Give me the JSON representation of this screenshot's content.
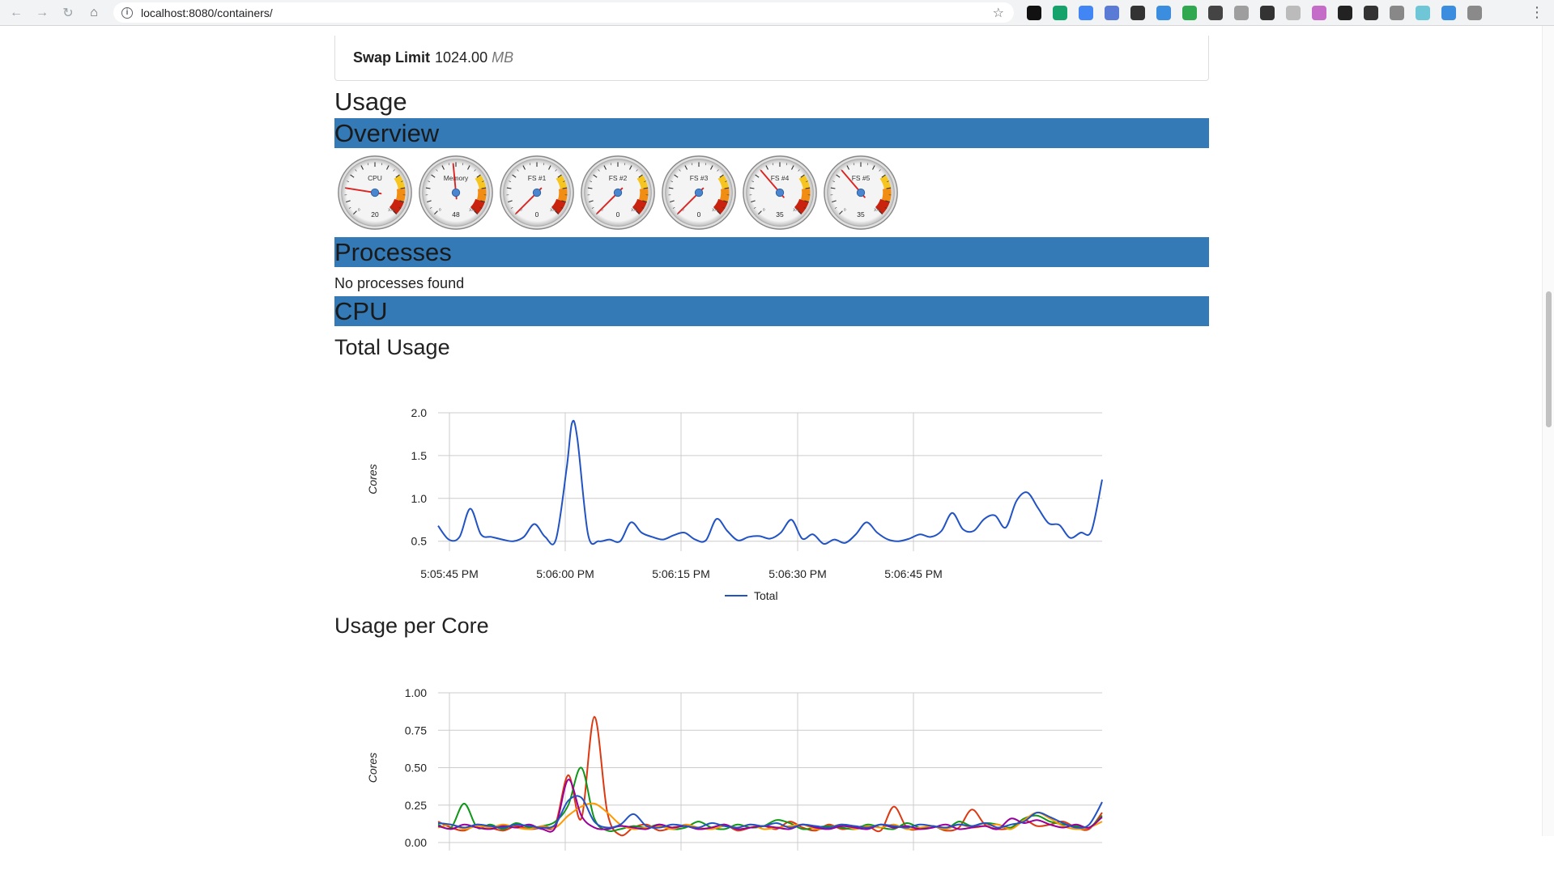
{
  "browser": {
    "url": "localhost:8080/containers/",
    "extensions": [
      "#111111",
      "#15a36b",
      "#4285f4",
      "#5a7bd5",
      "#333333",
      "#3b8de0",
      "#2fa84f",
      "#444444",
      "#9e9e9e",
      "#333333",
      "#bbbbbb",
      "#c56bc8",
      "#222222",
      "#333333",
      "#888888",
      "#6ec6d6",
      "#3b8de0",
      "#8a8a8a"
    ]
  },
  "machine": {
    "swap_label": "Swap Limit",
    "swap_value": "1024.00",
    "swap_unit": "MB"
  },
  "usage_title": "Usage",
  "sections": {
    "overview": "Overview",
    "processes": "Processes",
    "cpu": "CPU"
  },
  "no_processes": "No processes found",
  "gauges": [
    {
      "label": "CPU",
      "value": "20",
      "percent": 20
    },
    {
      "label": "Memory",
      "value": "48",
      "percent": 48
    },
    {
      "label": "FS #1",
      "value": "0",
      "percent": 0
    },
    {
      "label": "FS #2",
      "value": "0",
      "percent": 0
    },
    {
      "label": "FS #3",
      "value": "0",
      "percent": 0
    },
    {
      "label": "FS #4",
      "value": "35",
      "percent": 35
    },
    {
      "label": "FS #5",
      "value": "35",
      "percent": 35
    }
  ],
  "gauge_scale": {
    "min": "0",
    "max": "100"
  },
  "charts": {
    "total_title": "Total Usage",
    "per_core_title": "Usage per Core"
  },
  "chart_data": [
    {
      "type": "line",
      "ylabel": "Cores",
      "ylim": [
        0.45,
        2.0
      ],
      "yticks": [
        "2.0",
        "1.5",
        "1.0",
        "0.5"
      ],
      "ytick_values": [
        2.0,
        1.5,
        1.0,
        0.5
      ],
      "xlim": [
        0,
        60
      ],
      "xticks": [
        "5:05:45 PM",
        "5:06:00 PM",
        "5:06:15 PM",
        "5:06:30 PM",
        "5:06:45 PM"
      ],
      "xtick_values": [
        10,
        25,
        40,
        55,
        70
      ],
      "x_note_unused": null,
      "legend": "bottom",
      "series": [
        {
          "name": "Total",
          "color": "#2253c4",
          "points": [
            [
              0,
              0.68
            ],
            [
              1,
              0.52
            ],
            [
              2,
              0.55
            ],
            [
              3,
              0.88
            ],
            [
              4,
              0.58
            ],
            [
              5,
              0.55
            ],
            [
              6,
              0.52
            ],
            [
              7,
              0.5
            ],
            [
              8,
              0.55
            ],
            [
              9,
              0.7
            ],
            [
              10,
              0.55
            ],
            [
              11,
              0.52
            ],
            [
              12,
              1.35
            ],
            [
              12.5,
              1.88
            ],
            [
              13,
              1.7
            ],
            [
              14,
              0.58
            ],
            [
              15,
              0.5
            ],
            [
              16,
              0.52
            ],
            [
              17,
              0.5
            ],
            [
              18,
              0.72
            ],
            [
              19,
              0.6
            ],
            [
              20,
              0.55
            ],
            [
              21,
              0.52
            ],
            [
              22,
              0.57
            ],
            [
              23,
              0.6
            ],
            [
              24,
              0.52
            ],
            [
              25,
              0.51
            ],
            [
              26,
              0.76
            ],
            [
              27,
              0.62
            ],
            [
              28,
              0.51
            ],
            [
              29,
              0.55
            ],
            [
              30,
              0.56
            ],
            [
              31,
              0.53
            ],
            [
              32,
              0.6
            ],
            [
              33,
              0.75
            ],
            [
              34,
              0.53
            ],
            [
              35,
              0.58
            ],
            [
              36,
              0.47
            ],
            [
              37,
              0.52
            ],
            [
              38,
              0.48
            ],
            [
              39,
              0.58
            ],
            [
              40,
              0.72
            ],
            [
              41,
              0.6
            ],
            [
              42,
              0.52
            ],
            [
              43,
              0.5
            ],
            [
              44,
              0.53
            ],
            [
              45,
              0.58
            ],
            [
              46,
              0.55
            ],
            [
              47,
              0.62
            ],
            [
              48,
              0.83
            ],
            [
              49,
              0.64
            ],
            [
              50,
              0.62
            ],
            [
              51,
              0.76
            ],
            [
              52,
              0.8
            ],
            [
              53,
              0.66
            ],
            [
              54,
              0.97
            ],
            [
              55,
              1.07
            ],
            [
              56,
              0.89
            ],
            [
              57,
              0.71
            ],
            [
              58,
              0.69
            ],
            [
              59,
              0.54
            ],
            [
              60,
              0.6
            ],
            [
              61,
              0.62
            ],
            [
              62,
              1.22
            ]
          ]
        }
      ]
    },
    {
      "type": "line",
      "ylabel": "Cores",
      "ylim": [
        0,
        1.0
      ],
      "yticks": [
        "1.00",
        "0.75",
        "0.50",
        "0.25",
        "0.00"
      ],
      "ytick_values": [
        1.0,
        0.75,
        0.5,
        0.25,
        0.0
      ],
      "xticks": [],
      "series": [
        {
          "color": "#dc3912",
          "values": [
            0.14,
            0.1,
            0.08,
            0.12,
            0.1,
            0.08,
            0.11,
            0.09,
            0.1,
            0.12,
            0.45,
            0.16,
            0.84,
            0.2,
            0.05,
            0.1,
            0.12,
            0.08,
            0.1,
            0.11,
            0.09,
            0.1,
            0.12,
            0.08,
            0.1,
            0.11,
            0.09,
            0.14,
            0.1,
            0.08,
            0.12,
            0.09,
            0.1,
            0.11,
            0.08,
            0.24,
            0.1,
            0.09,
            0.11,
            0.08,
            0.1,
            0.22,
            0.12,
            0.09,
            0.1,
            0.15,
            0.11,
            0.12,
            0.14,
            0.1,
            0.09,
            0.2
          ]
        },
        {
          "color": "#109618",
          "values": [
            0.12,
            0.1,
            0.26,
            0.1,
            0.12,
            0.09,
            0.13,
            0.1,
            0.11,
            0.14,
            0.25,
            0.5,
            0.16,
            0.08,
            0.09,
            0.11,
            0.1,
            0.12,
            0.09,
            0.1,
            0.14,
            0.1,
            0.09,
            0.12,
            0.1,
            0.11,
            0.15,
            0.13,
            0.09,
            0.1,
            0.11,
            0.1,
            0.09,
            0.12,
            0.1,
            0.09,
            0.13,
            0.1,
            0.11,
            0.09,
            0.14,
            0.11,
            0.13,
            0.12,
            0.1,
            0.16,
            0.18,
            0.14,
            0.12,
            0.11,
            0.1,
            0.18
          ]
        },
        {
          "color": "#ff9900",
          "values": [
            0.1,
            0.12,
            0.09,
            0.11,
            0.1,
            0.12,
            0.1,
            0.09,
            0.11,
            0.1,
            0.18,
            0.24,
            0.26,
            0.2,
            0.12,
            0.09,
            0.1,
            0.11,
            0.09,
            0.12,
            0.1,
            0.09,
            0.11,
            0.1,
            0.12,
            0.09,
            0.1,
            0.11,
            0.12,
            0.09,
            0.1,
            0.12,
            0.09,
            0.11,
            0.1,
            0.12,
            0.09,
            0.1,
            0.11,
            0.09,
            0.12,
            0.1,
            0.11,
            0.12,
            0.09,
            0.15,
            0.2,
            0.16,
            0.11,
            0.09,
            0.1,
            0.14
          ]
        },
        {
          "color": "#990099",
          "values": [
            0.11,
            0.09,
            0.12,
            0.1,
            0.09,
            0.11,
            0.1,
            0.12,
            0.09,
            0.1,
            0.42,
            0.18,
            0.1,
            0.09,
            0.11,
            0.1,
            0.09,
            0.12,
            0.1,
            0.11,
            0.09,
            0.1,
            0.12,
            0.09,
            0.1,
            0.11,
            0.1,
            0.09,
            0.12,
            0.1,
            0.09,
            0.11,
            0.1,
            0.09,
            0.12,
            0.1,
            0.11,
            0.09,
            0.1,
            0.12,
            0.09,
            0.1,
            0.11,
            0.09,
            0.16,
            0.13,
            0.15,
            0.12,
            0.1,
            0.12,
            0.1,
            0.17
          ]
        },
        {
          "color": "#2253c4",
          "values": [
            0.13,
            0.12,
            0.1,
            0.12,
            0.11,
            0.1,
            0.12,
            0.11,
            0.1,
            0.12,
            0.28,
            0.3,
            0.14,
            0.1,
            0.12,
            0.19,
            0.11,
            0.1,
            0.12,
            0.11,
            0.1,
            0.13,
            0.11,
            0.1,
            0.12,
            0.11,
            0.13,
            0.1,
            0.12,
            0.11,
            0.1,
            0.12,
            0.11,
            0.1,
            0.12,
            0.11,
            0.1,
            0.12,
            0.11,
            0.1,
            0.12,
            0.11,
            0.13,
            0.1,
            0.12,
            0.14,
            0.2,
            0.17,
            0.13,
            0.1,
            0.12,
            0.27
          ]
        }
      ]
    }
  ]
}
